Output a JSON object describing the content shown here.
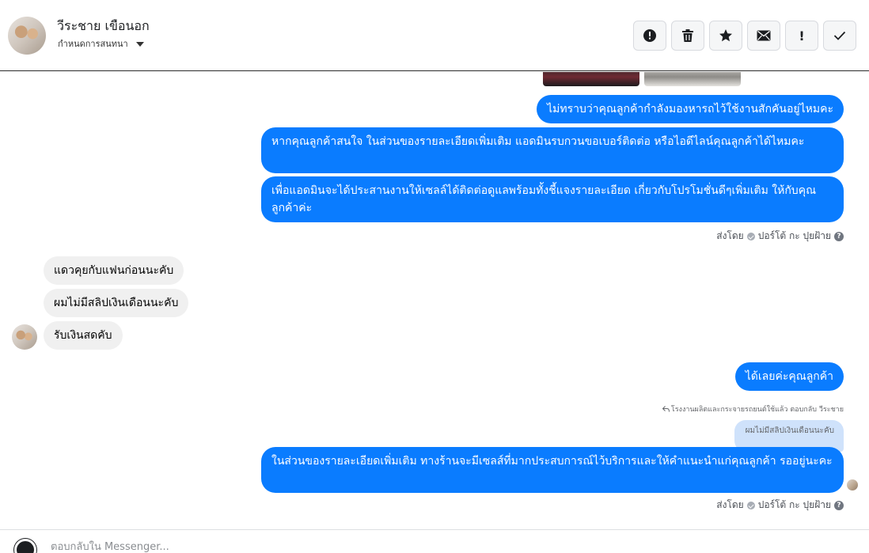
{
  "header": {
    "contact_name": "วีระชาย เขือนอก",
    "contact_sub": "กำหนดการสนทนา",
    "actions": [
      {
        "name": "report-spam-button",
        "icon": "alert-circle-icon"
      },
      {
        "name": "delete-button",
        "icon": "trash-icon"
      },
      {
        "name": "star-button",
        "icon": "star-icon"
      },
      {
        "name": "mark-unread-button",
        "icon": "envelope-icon"
      },
      {
        "name": "follow-up-button",
        "icon": "exclamation-icon",
        "label": "!"
      },
      {
        "name": "done-button",
        "icon": "checkmark-icon"
      }
    ]
  },
  "messages": {
    "out1": "ไม่ทราบว่าคุณลูกค้ากำลังมองหารถไว้ใช้งานสักคันอยู่ไหมคะ",
    "out2": "หากคุณลูกค้าสนใจ ในส่วนของรายละเอียดเพิ่มเติม แอดมินรบกวนขอเบอร์ติดต่อ หรือไอดีไลน์คุณลูกค้าได้ไหมคะ",
    "out3": "เพื่อแอดมินจะได้ประสานงานให้เซลล์ได้ติดต่อดูแลพร้อมทั้งชี้แจงรายละเอียด เกี่ยวกับโปรโมชั่นดีๆเพิ่มเติม ให้กับคุณลูกค้าค่ะ",
    "sent_by_prefix": "ส่งโดย",
    "sent_by_name": "ปอร์โต้ กะ ปุยฝ้าย",
    "in1": "แดวคุยกับแฟนก่อนนะคับ",
    "in2": "ผมไม่มีสลิปเงินเดือนนะคับ",
    "in3": "รับเงินสดคับ",
    "out4": "ได้เลยค่ะคุณลูกค้า",
    "reply_note": "โรงงานผลิตและกระจายรถยนต์ใช้แล้ว ตอบกลับ วีระชาย",
    "quoted": "ผมไม่มีสลิปเงินเดือนนะคับ",
    "out5": "ในส่วนของรายละเอียดเพิ่มเติม  ทางร้านจะมีเซลส์ที่มากประสบการณ์ไว้บริการและให้คำแนะนำแก่คุณลูกค้า รออยู่นะคะ",
    "help_glyph": "?"
  },
  "composer": {
    "placeholder": "ตอบกลับใน Messenger..."
  },
  "colors": {
    "outgoing": "#0a7cff",
    "incoming": "#f0f0f0",
    "quote": "#cfe2fb"
  }
}
